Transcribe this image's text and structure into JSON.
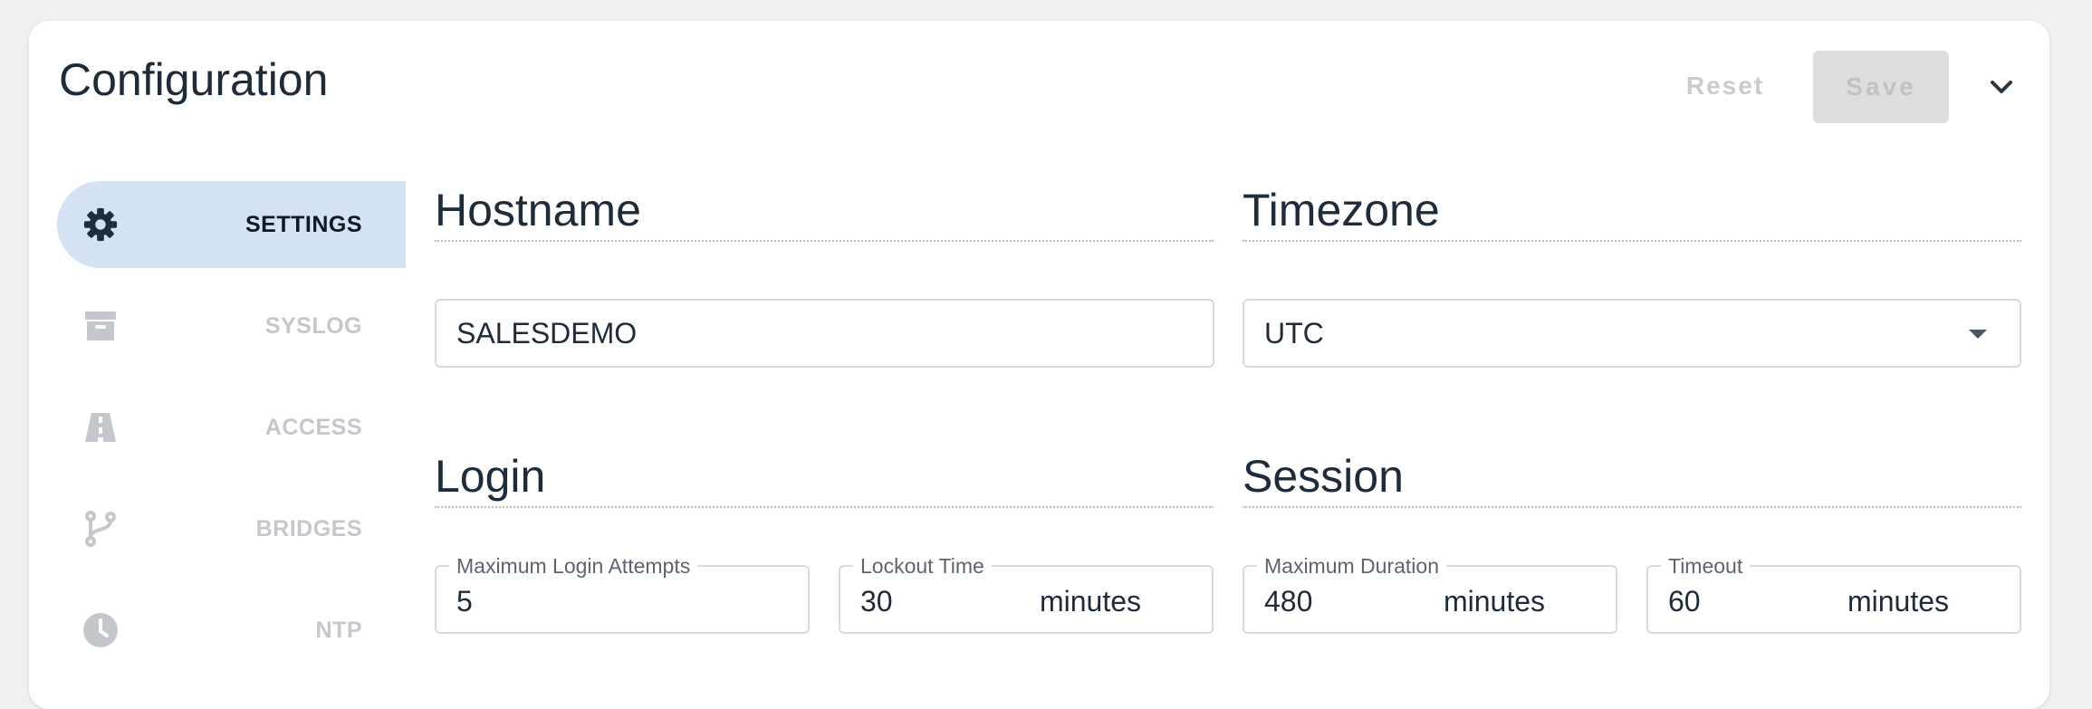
{
  "header": {
    "title": "Configuration",
    "reset_label": "Reset",
    "save_label": "Save",
    "collapse_icon": "chevron-down-icon"
  },
  "sidebar": {
    "items": [
      {
        "label": "SETTINGS",
        "icon": "gear-icon",
        "active": true
      },
      {
        "label": "SYSLOG",
        "icon": "archive-icon",
        "active": false
      },
      {
        "label": "ACCESS",
        "icon": "road-icon",
        "active": false
      },
      {
        "label": "BRIDGES",
        "icon": "branch-icon",
        "active": false
      },
      {
        "label": "NTP",
        "icon": "clock-icon",
        "active": false
      }
    ]
  },
  "hostname": {
    "title": "Hostname",
    "value": "SALESDEMO"
  },
  "timezone": {
    "title": "Timezone",
    "value": "UTC"
  },
  "login": {
    "title": "Login",
    "max_attempts": {
      "label": "Maximum Login Attempts",
      "value": "5"
    },
    "lockout_time": {
      "label": "Lockout Time",
      "value": "30",
      "unit": "minutes"
    }
  },
  "session": {
    "title": "Session",
    "max_duration": {
      "label": "Maximum Duration",
      "value": "480",
      "unit": "minutes"
    },
    "timeout": {
      "label": "Timeout",
      "value": "60",
      "unit": "minutes"
    }
  },
  "colors": {
    "accent_active_bg": "#d5e2f3",
    "text_dark": "#1e2b3a",
    "text_muted": "#c4c7cb"
  }
}
